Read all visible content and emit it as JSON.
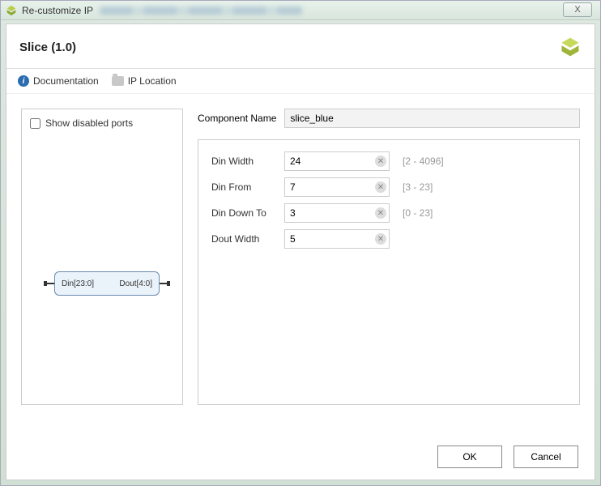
{
  "window": {
    "title": "Re-customize IP",
    "close_glyph": "X"
  },
  "header": {
    "title": "Slice (1.0)"
  },
  "links": {
    "documentation": "Documentation",
    "ip_location": "IP Location"
  },
  "left": {
    "show_disabled_label": "Show disabled ports",
    "show_disabled_checked": false,
    "diagram": {
      "din": "Din[23:0]",
      "dout": "Dout[4:0]"
    }
  },
  "right": {
    "component_name_label": "Component Name",
    "component_name_value": "slice_blue",
    "params": [
      {
        "label": "Din Width",
        "value": "24",
        "hint": "[2 - 4096]"
      },
      {
        "label": "Din From",
        "value": "7",
        "hint": "[3 - 23]"
      },
      {
        "label": "Din Down To",
        "value": "3",
        "hint": "[0 - 23]"
      },
      {
        "label": "Dout Width",
        "value": "5",
        "hint": ""
      }
    ]
  },
  "footer": {
    "ok": "OK",
    "cancel": "Cancel"
  }
}
